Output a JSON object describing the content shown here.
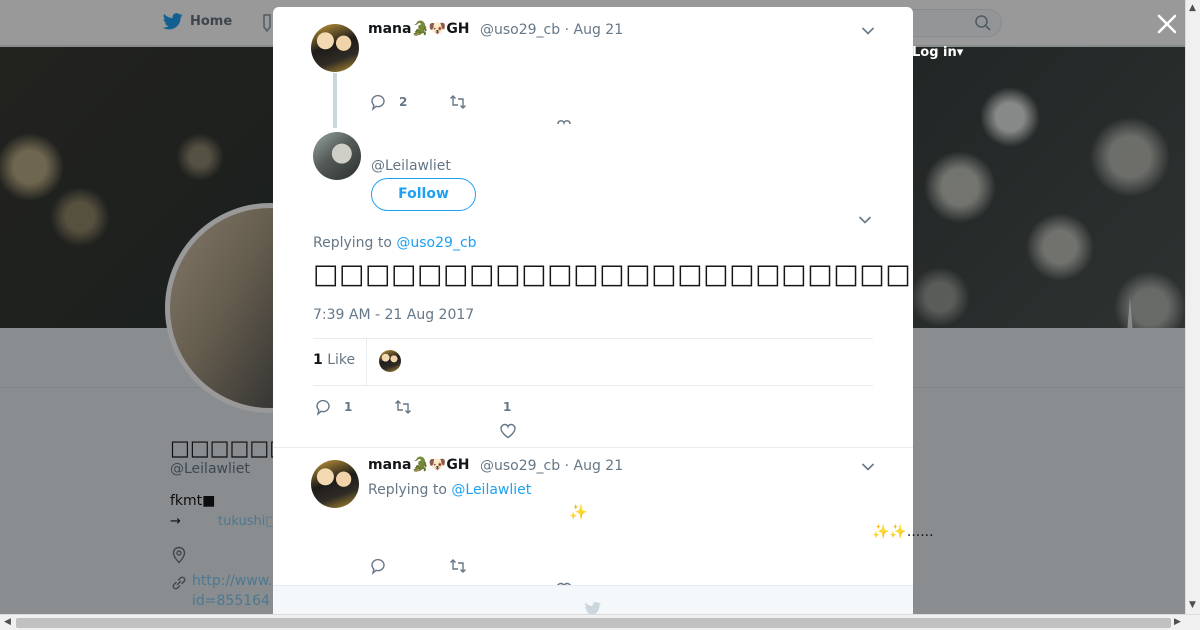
{
  "nav": {
    "home_label": "Home",
    "login_label": "Log in"
  },
  "profile": {
    "name": "□□□□□□□□",
    "handle": "@Leilawliet",
    "bio": "fkmt■",
    "bio_arrow": "→",
    "bio_link": "tukushi□",
    "url_line1": "http://www.",
    "url_line2": "id=855164"
  },
  "modal": {
    "tweet1": {
      "name": "mana🐊🐶GH",
      "handle": "@uso29_cb",
      "date": "· Aug 21",
      "reply_count": "2"
    },
    "main_tweet": {
      "handle": "@Leilawliet",
      "follow_label": "Follow",
      "replying_prefix": "Replying to",
      "replying_to": "@uso29_cb",
      "text": "□□□□□□□□□□□□□□□□□□□□□□□□□□□□□□□□□□□□□",
      "timestamp": "7:39 AM - 21 Aug 2017",
      "like_count": "1",
      "like_label": "Like",
      "reply_count": "1",
      "like_action_count": "1"
    },
    "tweet3": {
      "name": "mana🐊🐶GH",
      "handle": "@uso29_cb",
      "date": "· Aug 21",
      "replying_prefix": "Replying to",
      "replying_to": "@Leilawliet",
      "sparkle": "✨",
      "sparkle_text": "✨✨......"
    }
  },
  "colors": {
    "accent": "#1da1f2",
    "muted_text": "#657786",
    "overlay": "rgba(0,0,0,0.4)"
  },
  "icons": [
    "twitter-bird-icon",
    "notifications-icon",
    "search-icon",
    "close-icon",
    "chevron-down-icon",
    "reply-icon",
    "retweet-icon",
    "heart-icon",
    "location-icon",
    "link-icon"
  ]
}
